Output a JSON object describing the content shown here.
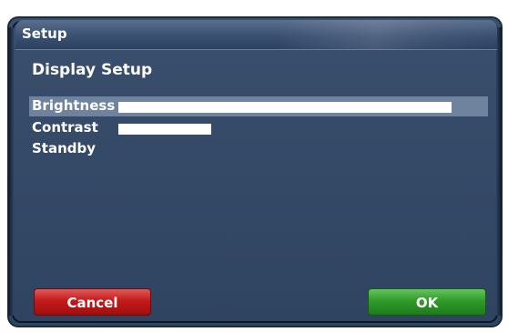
{
  "window": {
    "title": "Setup"
  },
  "main": {
    "heading": "Display Setup",
    "items": [
      {
        "label": "Brightness",
        "level": 1.0,
        "selected": true
      },
      {
        "label": "Contrast",
        "level": 0.28,
        "selected": false
      },
      {
        "label": "Standby",
        "level": null,
        "selected": false
      }
    ]
  },
  "buttons": {
    "cancel_label": "Cancel",
    "ok_label": "OK",
    "cancel_color": "#c41a1a",
    "ok_color": "#2f9b2a"
  },
  "colors": {
    "background": "#2f4461",
    "selection": "#6f839f",
    "text": "#ffffff"
  }
}
